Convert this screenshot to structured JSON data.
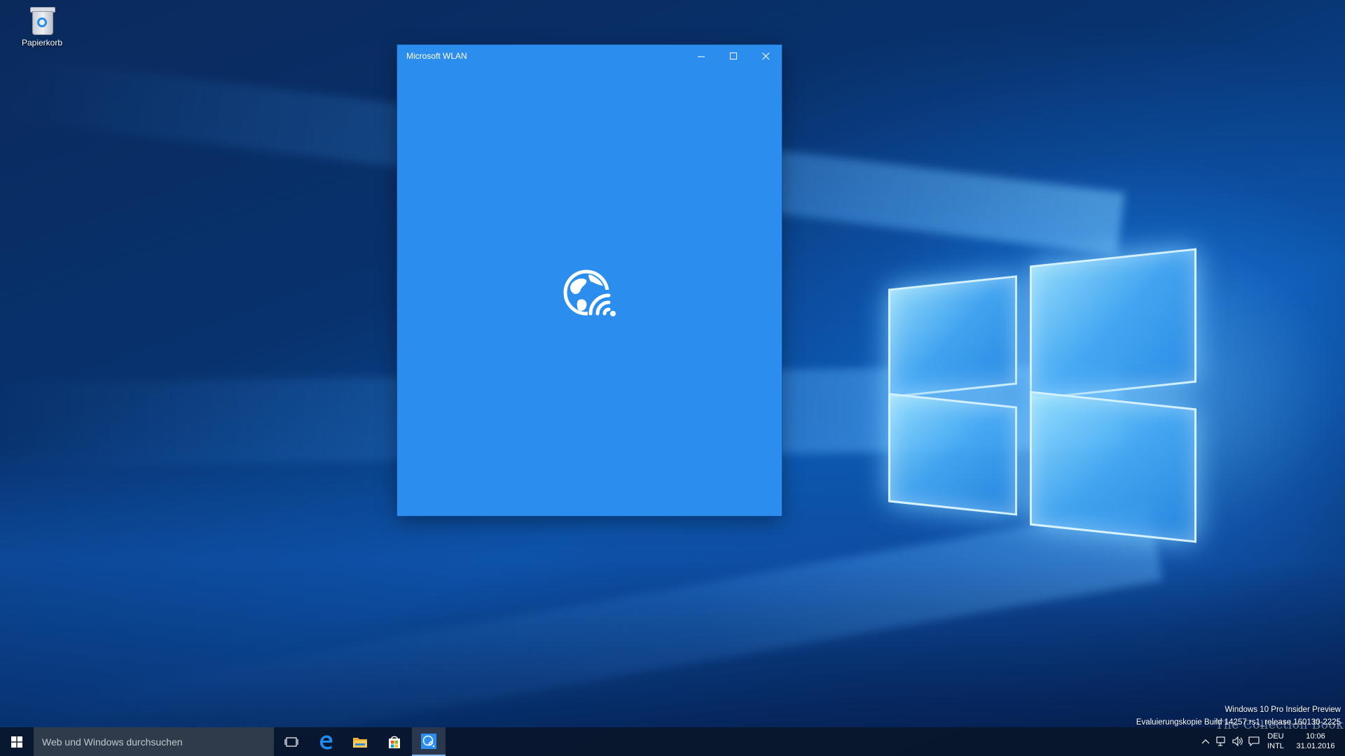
{
  "desktop": {
    "icons": [
      {
        "label": "Papierkorb",
        "icon": "recycle-bin-icon"
      }
    ]
  },
  "app_window": {
    "title": "Microsoft WLAN",
    "background_color": "#2b8ded",
    "buttons": {
      "minimize": "—",
      "maximize": "☐",
      "close": "✕"
    },
    "splash_icon": "globe-wifi-icon"
  },
  "watermark": {
    "line1": "Windows 10 Pro Insider Preview",
    "line2": "Evaluierungskopie Build 14257.rs1_release.160130-2225",
    "site_logo": "The Collection Book"
  },
  "taskbar": {
    "search_placeholder": "Web und Windows durchsuchen",
    "pinned": [
      {
        "name": "task-view",
        "icon": "task-view-icon"
      },
      {
        "name": "edge",
        "icon": "edge-icon"
      },
      {
        "name": "file-explorer",
        "icon": "folder-icon"
      },
      {
        "name": "store",
        "icon": "store-icon"
      },
      {
        "name": "microsoft-wlan",
        "icon": "globe-wifi-icon",
        "active": true
      }
    ],
    "tray": {
      "language_top": "DEU",
      "language_bottom": "INTL",
      "time": "10:06",
      "date": "31.01.2016"
    }
  },
  "colors": {
    "accent": "#2b8ded",
    "taskbar": "#08162c",
    "search_box": "#2f3b4a"
  }
}
